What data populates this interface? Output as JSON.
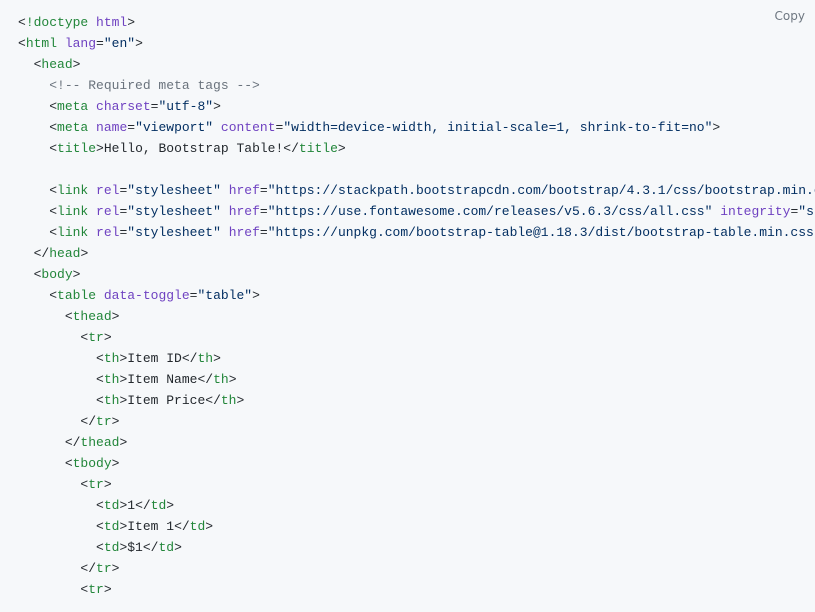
{
  "copyLabel": "Copy",
  "lines": [
    {
      "indent": 0,
      "segs": [
        [
          "punc",
          "<"
        ],
        [
          "tag",
          "!doctype "
        ],
        [
          "attr-name",
          "html"
        ],
        [
          "punc",
          ">"
        ]
      ]
    },
    {
      "indent": 0,
      "segs": [
        [
          "punc",
          "<"
        ],
        [
          "tag",
          "html "
        ],
        [
          "attr-name",
          "lang"
        ],
        [
          "punc",
          "="
        ],
        [
          "attr-val",
          "\"en\""
        ],
        [
          "punc",
          ">"
        ]
      ]
    },
    {
      "indent": 1,
      "segs": [
        [
          "punc",
          "<"
        ],
        [
          "tag",
          "head"
        ],
        [
          "punc",
          ">"
        ]
      ]
    },
    {
      "indent": 2,
      "segs": [
        [
          "comment",
          "<!-- Required meta tags -->"
        ]
      ]
    },
    {
      "indent": 2,
      "segs": [
        [
          "punc",
          "<"
        ],
        [
          "tag",
          "meta "
        ],
        [
          "attr-name",
          "charset"
        ],
        [
          "punc",
          "="
        ],
        [
          "attr-val",
          "\"utf-8\""
        ],
        [
          "punc",
          ">"
        ]
      ]
    },
    {
      "indent": 2,
      "segs": [
        [
          "punc",
          "<"
        ],
        [
          "tag",
          "meta "
        ],
        [
          "attr-name",
          "name"
        ],
        [
          "punc",
          "="
        ],
        [
          "attr-val",
          "\"viewport\""
        ],
        [
          "text",
          " "
        ],
        [
          "attr-name",
          "content"
        ],
        [
          "punc",
          "="
        ],
        [
          "attr-val",
          "\"width=device-width, initial-scale=1, shrink-to-fit=no\""
        ],
        [
          "punc",
          ">"
        ]
      ]
    },
    {
      "indent": 2,
      "segs": [
        [
          "punc",
          "<"
        ],
        [
          "tag",
          "title"
        ],
        [
          "punc",
          ">"
        ],
        [
          "text",
          "Hello, Bootstrap Table!"
        ],
        [
          "punc",
          "</"
        ],
        [
          "tag",
          "title"
        ],
        [
          "punc",
          ">"
        ]
      ]
    },
    {
      "indent": 0,
      "segs": []
    },
    {
      "indent": 2,
      "segs": [
        [
          "punc",
          "<"
        ],
        [
          "tag",
          "link "
        ],
        [
          "attr-name",
          "rel"
        ],
        [
          "punc",
          "="
        ],
        [
          "attr-val",
          "\"stylesheet\""
        ],
        [
          "text",
          " "
        ],
        [
          "attr-name",
          "href"
        ],
        [
          "punc",
          "="
        ],
        [
          "attr-val",
          "\"https://stackpath.bootstrapcdn.com/bootstrap/4.3.1/css/bootstrap.min.c"
        ]
      ]
    },
    {
      "indent": 2,
      "segs": [
        [
          "punc",
          "<"
        ],
        [
          "tag",
          "link "
        ],
        [
          "attr-name",
          "rel"
        ],
        [
          "punc",
          "="
        ],
        [
          "attr-val",
          "\"stylesheet\""
        ],
        [
          "text",
          " "
        ],
        [
          "attr-name",
          "href"
        ],
        [
          "punc",
          "="
        ],
        [
          "attr-val",
          "\"https://use.fontawesome.com/releases/v5.6.3/css/all.css\""
        ],
        [
          "text",
          " "
        ],
        [
          "attr-name",
          "integrity"
        ],
        [
          "punc",
          "="
        ],
        [
          "attr-val",
          "\"sh"
        ]
      ]
    },
    {
      "indent": 2,
      "segs": [
        [
          "punc",
          "<"
        ],
        [
          "tag",
          "link "
        ],
        [
          "attr-name",
          "rel"
        ],
        [
          "punc",
          "="
        ],
        [
          "attr-val",
          "\"stylesheet\""
        ],
        [
          "text",
          " "
        ],
        [
          "attr-name",
          "href"
        ],
        [
          "punc",
          "="
        ],
        [
          "attr-val",
          "\"https://unpkg.com/bootstrap-table@1.18.3/dist/bootstrap-table.min.css\""
        ]
      ]
    },
    {
      "indent": 1,
      "segs": [
        [
          "punc",
          "</"
        ],
        [
          "tag",
          "head"
        ],
        [
          "punc",
          ">"
        ]
      ]
    },
    {
      "indent": 1,
      "segs": [
        [
          "punc",
          "<"
        ],
        [
          "tag",
          "body"
        ],
        [
          "punc",
          ">"
        ]
      ]
    },
    {
      "indent": 2,
      "segs": [
        [
          "punc",
          "<"
        ],
        [
          "tag",
          "table "
        ],
        [
          "attr-name",
          "data-toggle"
        ],
        [
          "punc",
          "="
        ],
        [
          "attr-val",
          "\"table\""
        ],
        [
          "punc",
          ">"
        ]
      ]
    },
    {
      "indent": 3,
      "segs": [
        [
          "punc",
          "<"
        ],
        [
          "tag",
          "thead"
        ],
        [
          "punc",
          ">"
        ]
      ]
    },
    {
      "indent": 4,
      "segs": [
        [
          "punc",
          "<"
        ],
        [
          "tag",
          "tr"
        ],
        [
          "punc",
          ">"
        ]
      ]
    },
    {
      "indent": 5,
      "segs": [
        [
          "punc",
          "<"
        ],
        [
          "tag",
          "th"
        ],
        [
          "punc",
          ">"
        ],
        [
          "text",
          "Item ID"
        ],
        [
          "punc",
          "</"
        ],
        [
          "tag",
          "th"
        ],
        [
          "punc",
          ">"
        ]
      ]
    },
    {
      "indent": 5,
      "segs": [
        [
          "punc",
          "<"
        ],
        [
          "tag",
          "th"
        ],
        [
          "punc",
          ">"
        ],
        [
          "text",
          "Item Name"
        ],
        [
          "punc",
          "</"
        ],
        [
          "tag",
          "th"
        ],
        [
          "punc",
          ">"
        ]
      ]
    },
    {
      "indent": 5,
      "segs": [
        [
          "punc",
          "<"
        ],
        [
          "tag",
          "th"
        ],
        [
          "punc",
          ">"
        ],
        [
          "text",
          "Item Price"
        ],
        [
          "punc",
          "</"
        ],
        [
          "tag",
          "th"
        ],
        [
          "punc",
          ">"
        ]
      ]
    },
    {
      "indent": 4,
      "segs": [
        [
          "punc",
          "</"
        ],
        [
          "tag",
          "tr"
        ],
        [
          "punc",
          ">"
        ]
      ]
    },
    {
      "indent": 3,
      "segs": [
        [
          "punc",
          "</"
        ],
        [
          "tag",
          "thead"
        ],
        [
          "punc",
          ">"
        ]
      ]
    },
    {
      "indent": 3,
      "segs": [
        [
          "punc",
          "<"
        ],
        [
          "tag",
          "tbody"
        ],
        [
          "punc",
          ">"
        ]
      ]
    },
    {
      "indent": 4,
      "segs": [
        [
          "punc",
          "<"
        ],
        [
          "tag",
          "tr"
        ],
        [
          "punc",
          ">"
        ]
      ]
    },
    {
      "indent": 5,
      "segs": [
        [
          "punc",
          "<"
        ],
        [
          "tag",
          "td"
        ],
        [
          "punc",
          ">"
        ],
        [
          "text",
          "1"
        ],
        [
          "punc",
          "</"
        ],
        [
          "tag",
          "td"
        ],
        [
          "punc",
          ">"
        ]
      ]
    },
    {
      "indent": 5,
      "segs": [
        [
          "punc",
          "<"
        ],
        [
          "tag",
          "td"
        ],
        [
          "punc",
          ">"
        ],
        [
          "text",
          "Item 1"
        ],
        [
          "punc",
          "</"
        ],
        [
          "tag",
          "td"
        ],
        [
          "punc",
          ">"
        ]
      ]
    },
    {
      "indent": 5,
      "segs": [
        [
          "punc",
          "<"
        ],
        [
          "tag",
          "td"
        ],
        [
          "punc",
          ">"
        ],
        [
          "text",
          "$1"
        ],
        [
          "punc",
          "</"
        ],
        [
          "tag",
          "td"
        ],
        [
          "punc",
          ">"
        ]
      ]
    },
    {
      "indent": 4,
      "segs": [
        [
          "punc",
          "</"
        ],
        [
          "tag",
          "tr"
        ],
        [
          "punc",
          ">"
        ]
      ]
    },
    {
      "indent": 4,
      "segs": [
        [
          "punc",
          "<"
        ],
        [
          "tag",
          "tr"
        ],
        [
          "punc",
          ">"
        ]
      ]
    }
  ]
}
